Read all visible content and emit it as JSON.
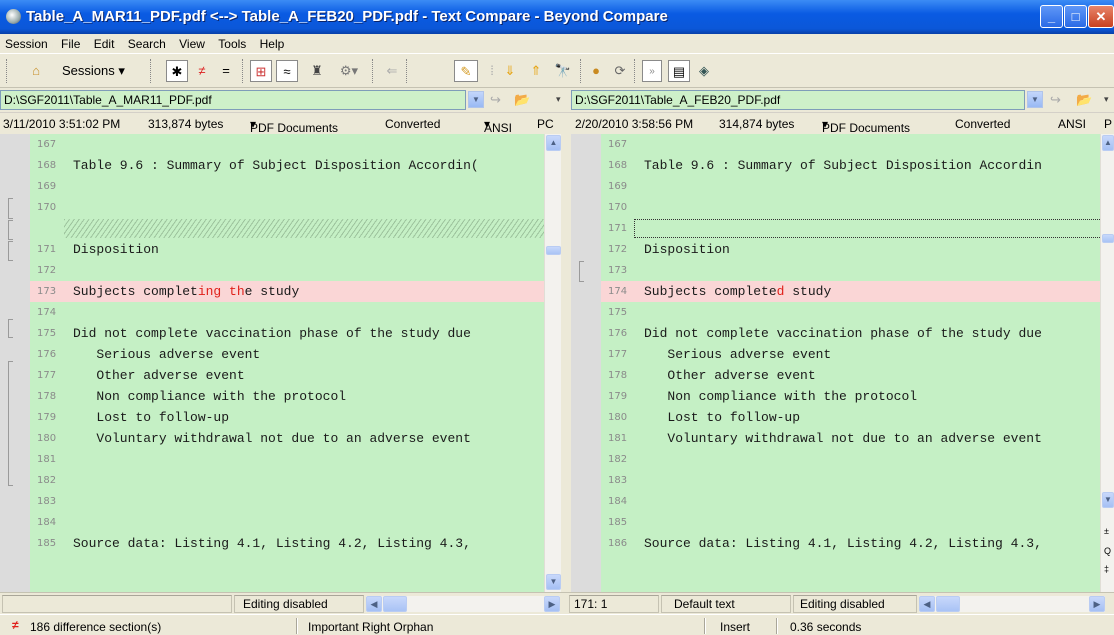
{
  "window": {
    "title": "Table_A_MAR11_PDF.pdf <--> Table_A_FEB20_PDF.pdf - Text Compare - Beyond Compare"
  },
  "menu": [
    "Session",
    "File",
    "Edit",
    "Search",
    "View",
    "Tools",
    "Help"
  ],
  "toolbar": {
    "sessions_label": "Sessions"
  },
  "left": {
    "path": "D:\\SGF2011\\Table_A_MAR11_PDF.pdf",
    "info": {
      "date": "3/11/2010 3:51:02 PM",
      "size": "313,874 bytes",
      "format": "PDF Documents",
      "converted": "Converted",
      "encoding": "ANSI",
      "lineend": "PC"
    },
    "rows": [
      {
        "num": "167",
        "text": ""
      },
      {
        "num": "168",
        "text": "Table 9.6 : Summary of Subject Disposition Accordin("
      },
      {
        "num": "169",
        "text": ""
      },
      {
        "num": "170",
        "text": ""
      },
      {
        "num": "",
        "text": ""
      },
      {
        "num": "171",
        "text": "Disposition"
      },
      {
        "num": "172",
        "text": ""
      },
      {
        "num": "173",
        "text": "Subjects complet",
        "diff": "ing th",
        "tail": "e study"
      },
      {
        "num": "174",
        "text": ""
      },
      {
        "num": "175",
        "text": "Did not complete vaccination phase of the study due"
      },
      {
        "num": "176",
        "text": "   Serious adverse event"
      },
      {
        "num": "177",
        "text": "   Other adverse event"
      },
      {
        "num": "178",
        "text": "   Non compliance with the protocol"
      },
      {
        "num": "179",
        "text": "   Lost to follow-up"
      },
      {
        "num": "180",
        "text": "   Voluntary withdrawal not due to an adverse event"
      },
      {
        "num": "181",
        "text": ""
      },
      {
        "num": "182",
        "text": ""
      },
      {
        "num": "183",
        "text": ""
      },
      {
        "num": "184",
        "text": ""
      },
      {
        "num": "185",
        "text": "Source data: Listing 4.1, Listing 4.2, Listing 4.3,"
      }
    ],
    "status": {
      "editing": "Editing disabled"
    }
  },
  "right": {
    "path": "D:\\SGF2011\\Table_A_FEB20_PDF.pdf",
    "info": {
      "date": "2/20/2010 3:58:56 PM",
      "size": "314,874 bytes",
      "format": "PDF Documents",
      "converted": "Converted",
      "encoding": "ANSI",
      "lineend": "P"
    },
    "rows": [
      {
        "num": "167",
        "text": ""
      },
      {
        "num": "168",
        "text": "Table 9.6 : Summary of Subject Disposition Accordin"
      },
      {
        "num": "169",
        "text": ""
      },
      {
        "num": "170",
        "text": ""
      },
      {
        "num": "171",
        "text": ""
      },
      {
        "num": "172",
        "text": "Disposition"
      },
      {
        "num": "173",
        "text": ""
      },
      {
        "num": "174",
        "text": "Subjects complete",
        "diff": "d",
        "tail": " study"
      },
      {
        "num": "175",
        "text": ""
      },
      {
        "num": "176",
        "text": "Did not complete vaccination phase of the study due"
      },
      {
        "num": "177",
        "text": "   Serious adverse event"
      },
      {
        "num": "178",
        "text": "   Other adverse event"
      },
      {
        "num": "179",
        "text": "   Non compliance with the protocol"
      },
      {
        "num": "180",
        "text": "   Lost to follow-up"
      },
      {
        "num": "181",
        "text": "   Voluntary withdrawal not due to an adverse event"
      },
      {
        "num": "182",
        "text": ""
      },
      {
        "num": "183",
        "text": ""
      },
      {
        "num": "184",
        "text": ""
      },
      {
        "num": "185",
        "text": ""
      },
      {
        "num": "186",
        "text": "Source data: Listing 4.1, Listing 4.2, Listing 4.3,"
      }
    ],
    "status": {
      "position": "171: 1",
      "text_type": "Default text",
      "editing": "Editing disabled"
    }
  },
  "statusbar": {
    "differences": "186 difference section(s)",
    "rule": "Important Right Orphan",
    "mode": "Insert",
    "time": "0.36 seconds"
  },
  "colors": {
    "match_bg": "#c5f0c5",
    "diff_bg": "#fad6d6",
    "diff_text": "#e0201a",
    "title_blue": "#0b57d8"
  }
}
